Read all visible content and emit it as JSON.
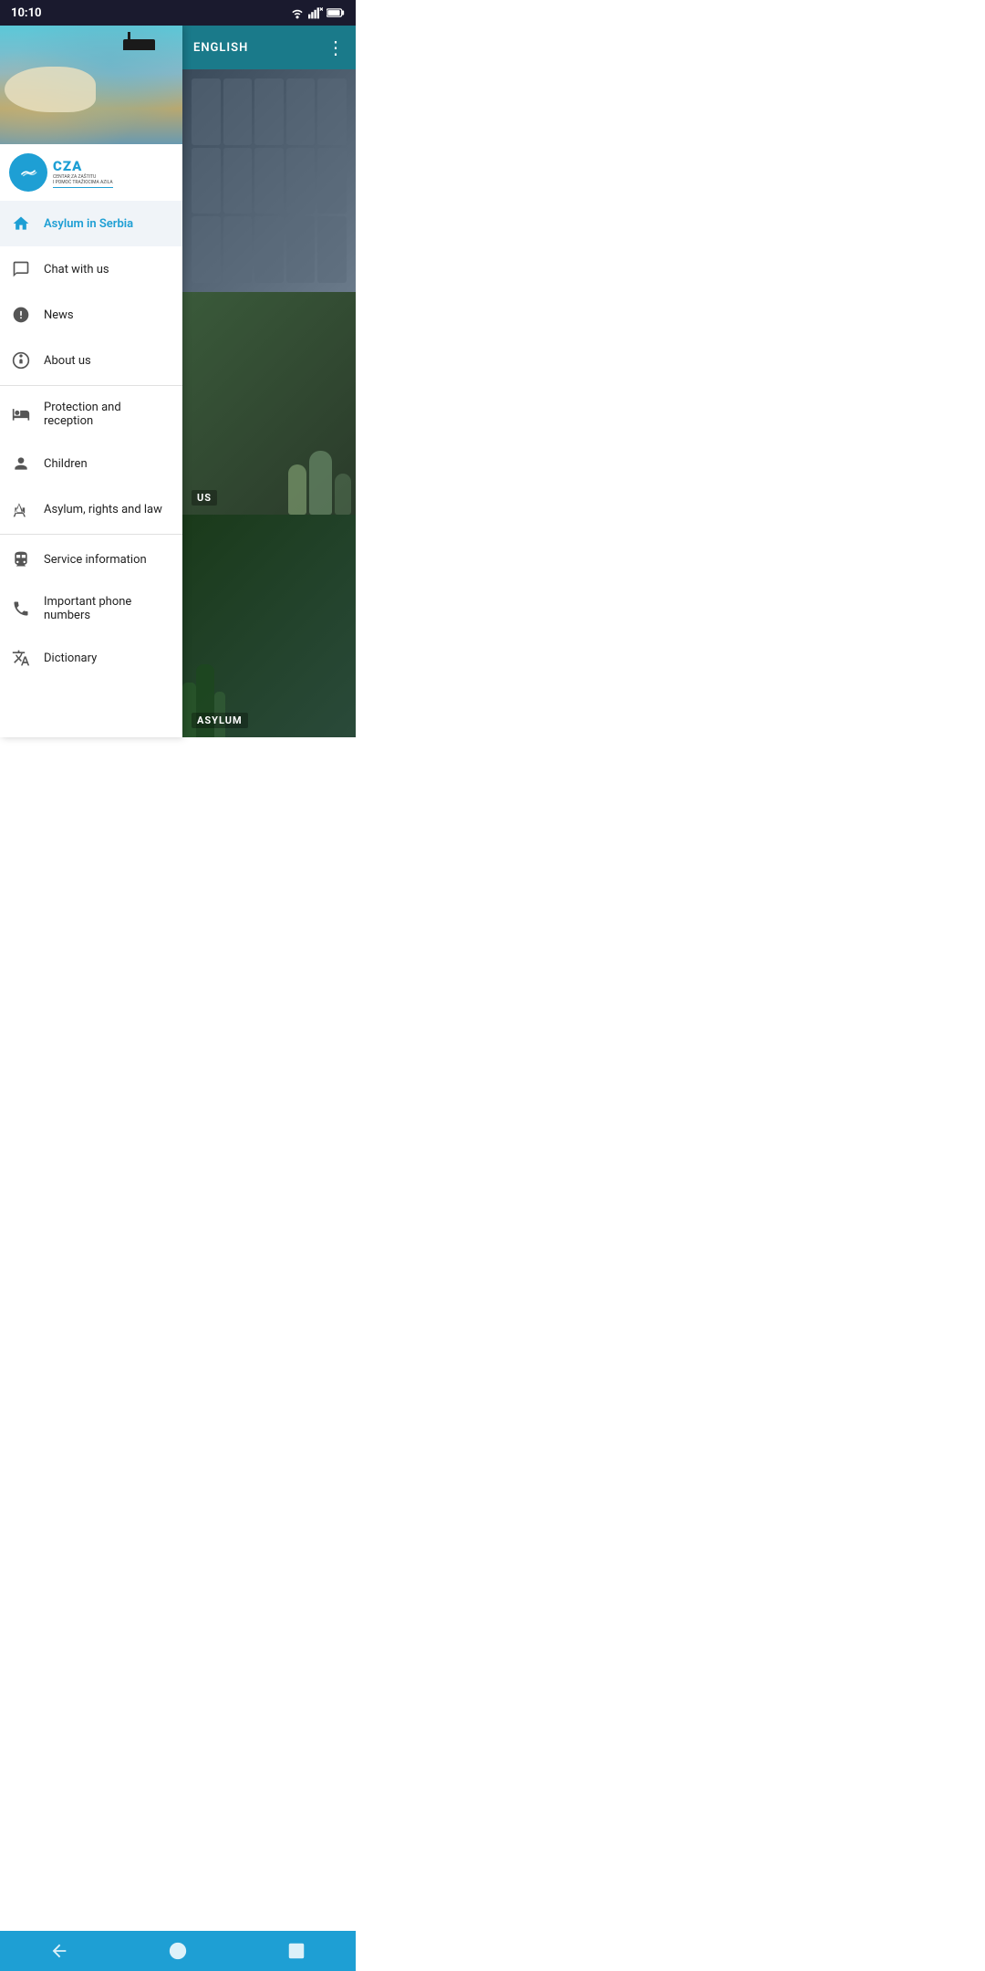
{
  "statusBar": {
    "time": "10:10",
    "icons": [
      "wifi",
      "signal",
      "battery"
    ]
  },
  "topBar": {
    "language": "ENGLISH",
    "menuDots": "⋮"
  },
  "logo": {
    "name": "CZA",
    "subtitle1": "CENTAR ZA ZAŠTITU",
    "subtitle2": "I POMOĆ TRAŽIOCIMA AZILA"
  },
  "navItems": [
    {
      "id": "asylum-in-serbia",
      "label": "Asylum in Serbia",
      "icon": "home",
      "active": true
    },
    {
      "id": "chat-with-us",
      "label": "Chat with us",
      "icon": "chat",
      "active": false
    },
    {
      "id": "news",
      "label": "News",
      "icon": "news",
      "active": false
    },
    {
      "id": "about-us",
      "label": "About us",
      "icon": "about",
      "active": false
    },
    {
      "id": "protection-and-reception",
      "label": "Protection and reception",
      "icon": "bed",
      "active": false
    },
    {
      "id": "children",
      "label": "Children",
      "icon": "child",
      "active": false
    },
    {
      "id": "asylum-rights-law",
      "label": "Asylum, rights and law",
      "icon": "law",
      "active": false
    },
    {
      "id": "service-information",
      "label": "Service information",
      "icon": "train",
      "active": false
    },
    {
      "id": "important-phone-numbers",
      "label": "Important phone numbers",
      "icon": "phone",
      "active": false
    },
    {
      "id": "dictionary",
      "label": "Dictionary",
      "icon": "translate",
      "active": false
    }
  ],
  "contentCards": [
    {
      "id": "card-1",
      "label": ""
    },
    {
      "id": "card-2",
      "label": "US"
    },
    {
      "id": "card-3",
      "label": "ASYLUM"
    }
  ],
  "bottomNav": {
    "back": "◀",
    "home": "●",
    "recent": "■"
  }
}
